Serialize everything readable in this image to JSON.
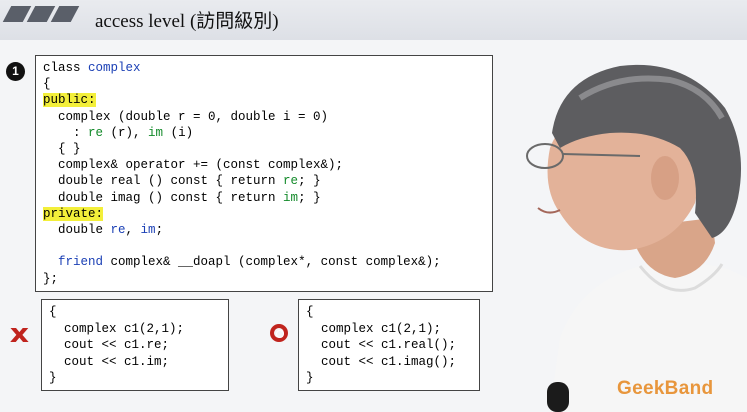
{
  "header": {
    "title": "access level (訪問級別)"
  },
  "badge": {
    "number": "1"
  },
  "code_main": [
    {
      "t": "class ",
      "parts": [
        [
          "class ",
          ""
        ],
        [
          "complex",
          "kw"
        ]
      ]
    },
    {
      "parts": [
        [
          "{",
          ""
        ]
      ]
    },
    {
      "parts": [
        [
          "public:",
          "hl"
        ]
      ]
    },
    {
      "parts": [
        [
          "  complex (double r = 0, double i = 0)",
          ""
        ]
      ]
    },
    {
      "parts": [
        [
          "    : ",
          ""
        ],
        [
          "re",
          "mem"
        ],
        [
          " (r), ",
          ""
        ],
        [
          "im",
          "mem"
        ],
        [
          " (i)",
          ""
        ]
      ]
    },
    {
      "parts": [
        [
          "  { }",
          ""
        ]
      ]
    },
    {
      "parts": [
        [
          "  complex& operator += (const complex&);",
          ""
        ]
      ]
    },
    {
      "parts": [
        [
          "  double real () const { return ",
          ""
        ],
        [
          "re",
          "mem"
        ],
        [
          "; }",
          ""
        ]
      ]
    },
    {
      "parts": [
        [
          "  double imag () const { return ",
          ""
        ],
        [
          "im",
          "mem"
        ],
        [
          "; }",
          ""
        ]
      ]
    },
    {
      "parts": [
        [
          "private:",
          "hl"
        ]
      ]
    },
    {
      "parts": [
        [
          "  double ",
          ""
        ],
        [
          "re",
          "kw"
        ],
        [
          ", ",
          ""
        ],
        [
          "im",
          "kw"
        ],
        [
          ";",
          ""
        ]
      ]
    },
    {
      "parts": [
        [
          "",
          ""
        ]
      ]
    },
    {
      "parts": [
        [
          "  ",
          ""
        ],
        [
          "friend",
          "kw"
        ],
        [
          " complex& __doapl (complex*, const complex&);",
          ""
        ]
      ]
    },
    {
      "parts": [
        [
          "};",
          ""
        ]
      ]
    }
  ],
  "code_bad": [
    "{",
    "  complex c1(2,1);",
    "  cout << c1.re;",
    "  cout << c1.im;",
    "}"
  ],
  "code_good": [
    "{",
    "  complex c1(2,1);",
    "  cout << c1.real();",
    "  cout << c1.imag();",
    "}"
  ],
  "marks": {
    "bad": "x",
    "good": "o"
  },
  "watermark": {
    "brand": "GeekBand"
  },
  "colors": {
    "keyword": "#1a3fb5",
    "member": "#138a2a",
    "highlight": "#f3ef3a",
    "mark": "#c0241e",
    "brand": "#e8963c"
  }
}
